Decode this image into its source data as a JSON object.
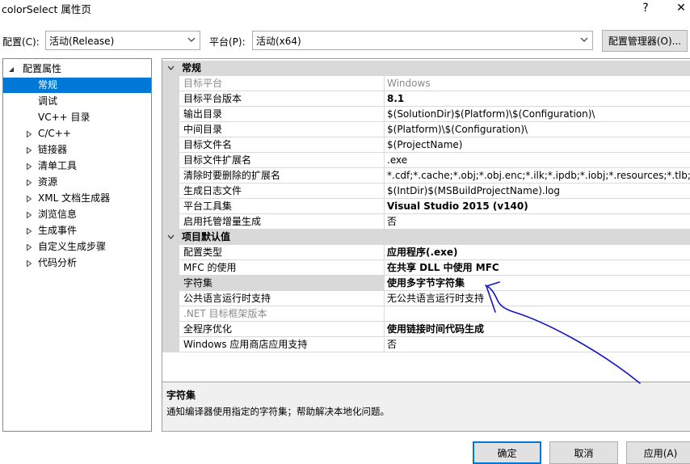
{
  "window": {
    "title": "colorSelect 属性页",
    "help": "?",
    "close": "✕"
  },
  "toolbar": {
    "config_label": "配置(C):",
    "config_value": "活动(Release)",
    "platform_label": "平台(P):",
    "platform_value": "活动(x64)",
    "config_manager": "配置管理器(O)..."
  },
  "tree": [
    {
      "label": "配置属性",
      "level": 0,
      "expander": "open"
    },
    {
      "label": "常规",
      "level": 1,
      "expander": "none",
      "selected": true
    },
    {
      "label": "调试",
      "level": 1,
      "expander": "none"
    },
    {
      "label": "VC++ 目录",
      "level": 1,
      "expander": "none"
    },
    {
      "label": "C/C++",
      "level": 1,
      "expander": "closed"
    },
    {
      "label": "链接器",
      "level": 1,
      "expander": "closed"
    },
    {
      "label": "清单工具",
      "level": 1,
      "expander": "closed"
    },
    {
      "label": "资源",
      "level": 1,
      "expander": "closed"
    },
    {
      "label": "XML 文档生成器",
      "level": 1,
      "expander": "closed"
    },
    {
      "label": "浏览信息",
      "level": 1,
      "expander": "closed"
    },
    {
      "label": "生成事件",
      "level": 1,
      "expander": "closed"
    },
    {
      "label": "自定义生成步骤",
      "level": 1,
      "expander": "closed"
    },
    {
      "label": "代码分析",
      "level": 1,
      "expander": "closed"
    }
  ],
  "grid": {
    "sections": [
      {
        "title": "常规",
        "rows": [
          {
            "name": "目标平台",
            "value": "Windows",
            "disabled": true
          },
          {
            "name": "目标平台版本",
            "value": "8.1",
            "bold": true
          },
          {
            "name": "输出目录",
            "value": "$(SolutionDir)$(Platform)\\$(Configuration)\\"
          },
          {
            "name": "中间目录",
            "value": "$(Platform)\\$(Configuration)\\"
          },
          {
            "name": "目标文件名",
            "value": "$(ProjectName)"
          },
          {
            "name": "目标文件扩展名",
            "value": ".exe"
          },
          {
            "name": "清除时要删除的扩展名",
            "value": "*.cdf;*.cache;*.obj;*.obj.enc;*.ilk;*.ipdb;*.iobj;*.resources;*.tlb;*.tli;*.t"
          },
          {
            "name": "生成日志文件",
            "value": "$(IntDir)$(MSBuildProjectName).log"
          },
          {
            "name": "平台工具集",
            "value": "Visual Studio 2015 (v140)",
            "bold": true
          },
          {
            "name": "启用托管增量生成",
            "value": "否"
          }
        ]
      },
      {
        "title": "项目默认值",
        "rows": [
          {
            "name": "配置类型",
            "value": "应用程序(.exe)",
            "bold": true
          },
          {
            "name": "MFC 的使用",
            "value": "在共享 DLL 中使用 MFC",
            "bold": true
          },
          {
            "name": "字符集",
            "value": "使用多字节字符集",
            "bold": true,
            "selected": true
          },
          {
            "name": "公共语言运行时支持",
            "value": "无公共语言运行时支持"
          },
          {
            "name": ".NET 目标框架版本",
            "value": "",
            "disabled": true
          },
          {
            "name": "全程序优化",
            "value": "使用链接时间代码生成",
            "bold": true
          },
          {
            "name": "Windows 应用商店应用支持",
            "value": "否"
          }
        ]
      }
    ]
  },
  "description": {
    "title": "字符集",
    "text": "通知编译器使用指定的字符集；帮助解决本地化问题。"
  },
  "buttons": {
    "ok": "确定",
    "cancel": "取消",
    "apply": "应用(A)"
  },
  "annotation": {
    "color": "#1515c8"
  }
}
